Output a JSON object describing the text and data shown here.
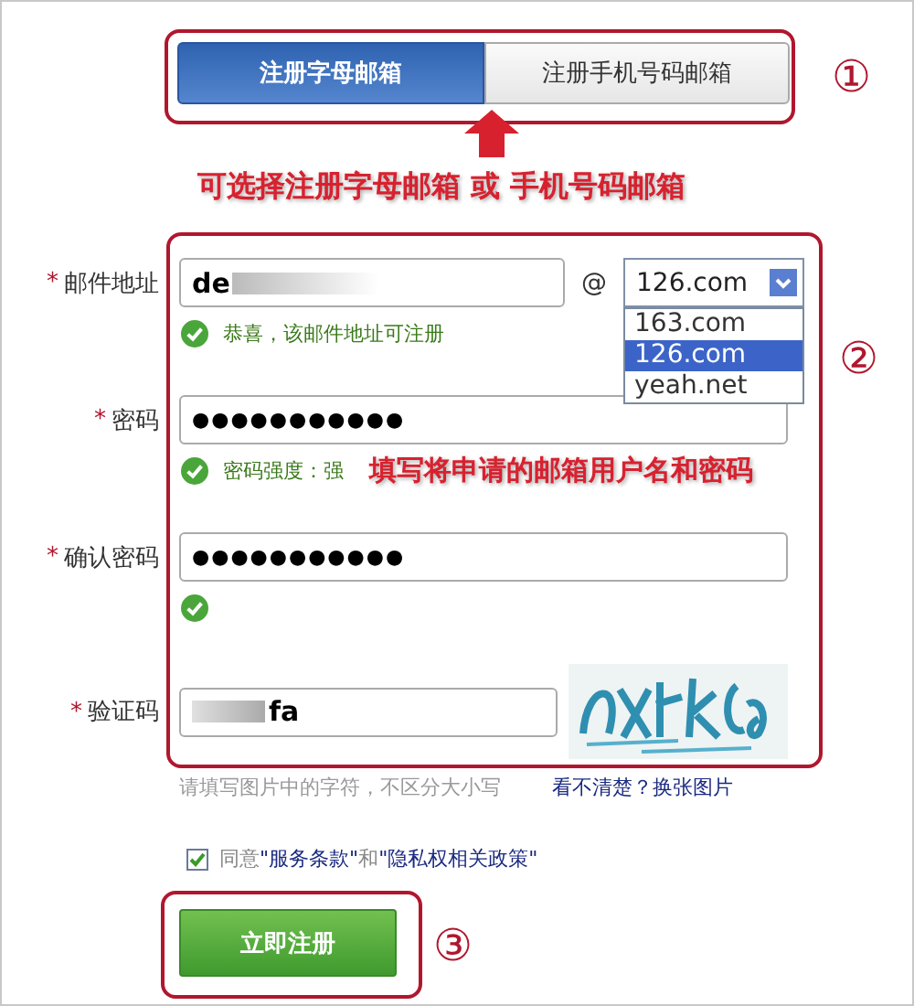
{
  "step_1": {
    "marker": "①",
    "tabs": [
      {
        "label": "注册字母邮箱",
        "selected": true
      },
      {
        "label": "注册手机号码邮箱",
        "selected": false
      }
    ],
    "note": "可选择注册字母邮箱 或 手机号码邮箱"
  },
  "step_2": {
    "marker": "②",
    "note": "填写将申请的邮箱用户名和密码"
  },
  "fields": [
    {
      "kind": "email",
      "mark": "*",
      "label": "邮件地址",
      "value": "de",
      "at": "@",
      "domain": "126.com",
      "expanded": true,
      "options": [
        {
          "label": "163.com",
          "selected": false
        },
        {
          "label": "126.com",
          "selected": true
        },
        {
          "label": "yeah.net",
          "selected": false
        }
      ],
      "valid": true,
      "status": "恭喜，该邮件地址可注册"
    },
    {
      "kind": "password",
      "mark": "*",
      "label": "密码",
      "value": "●●●●●●●●●●●",
      "valid": true,
      "status": "密码强度：强"
    },
    {
      "kind": "password",
      "mark": "*",
      "label": "确认密码",
      "value": "●●●●●●●●●●●",
      "valid": true
    },
    {
      "kind": "captcha",
      "mark": "*",
      "label": "验证码",
      "value": "fa"
    }
  ],
  "captcha_hint": "请填写图片中的字符，不区分大小写",
  "captcha_link": "看不清楚？换张图片",
  "agree": {
    "checked": true,
    "prefix": "同意",
    "terms": "\"服务条款\"",
    "middle": "和",
    "privacy": "\"隐私权相关政策\""
  },
  "step_3": {
    "marker": "③",
    "button": "立即注册"
  }
}
